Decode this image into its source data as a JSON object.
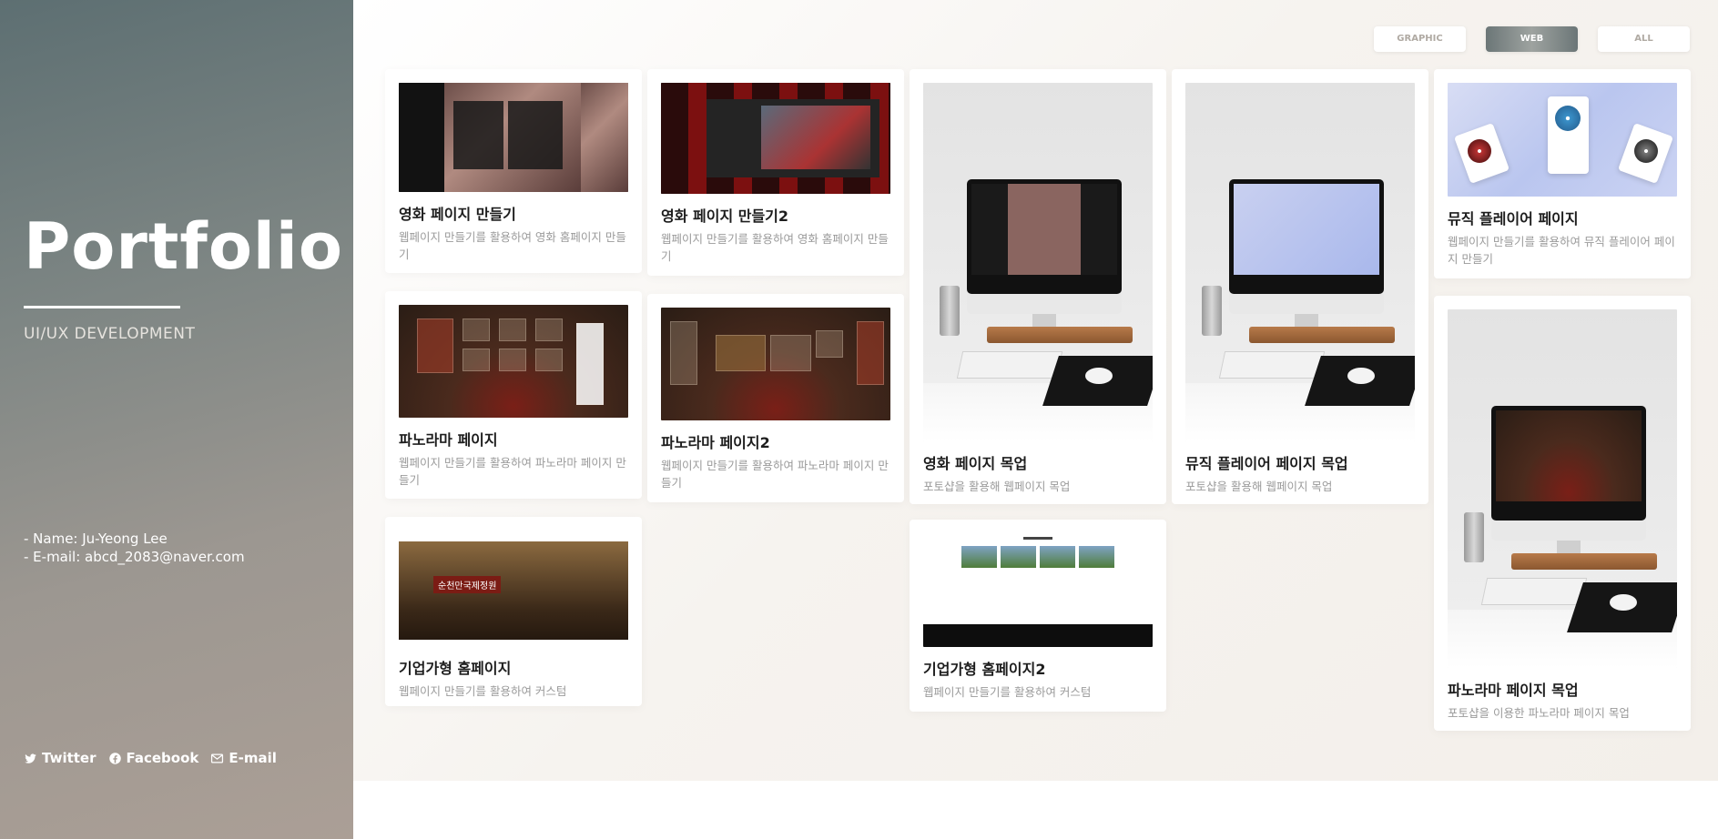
{
  "sidebar": {
    "title": "Portfolio",
    "subtitle": "UI/UX DEVELOPMENT",
    "name_line": "- Name: Ju-Yeong Lee",
    "email_line": "- E-mail: abcd_2083@naver.com",
    "social": [
      {
        "label": "Twitter",
        "icon": "twitter-icon"
      },
      {
        "label": "Facebook",
        "icon": "facebook-icon"
      },
      {
        "label": "E-mail",
        "icon": "mail-icon"
      }
    ]
  },
  "filters": [
    {
      "label": "GRAPHIC",
      "active": false
    },
    {
      "label": "WEB",
      "active": true
    },
    {
      "label": "ALL",
      "active": false
    }
  ],
  "cards": [
    {
      "title": "영화 페이지 만들기",
      "desc": "웹페이지 만들기를 활용하여 영화 홈페이지 만들기"
    },
    {
      "title": "영화 페이지 만들기2",
      "desc": "웹페이지 만들기를 활용하여 영화 홈페이지 만들기"
    },
    {
      "title": "영화 페이지 목업",
      "desc": "포토샵을 활용해 웹페이지 목업"
    },
    {
      "title": "뮤직 플레이어 페이지 목업",
      "desc": "포토샵을 활용해 웹페이지 목업"
    },
    {
      "title": "뮤직 플레이어 페이지",
      "desc": "웹페이지 만들기를 활용하여 뮤직 플레이어 페이지 만들기"
    },
    {
      "title": "파노라마 페이지",
      "desc": "웹페이지 만들기를 활용하여 파노라마 페이지 만들기"
    },
    {
      "title": "파노라마 페이지2",
      "desc": "웹페이지 만들기를 활용하여 파노라마 페이지 만들기"
    },
    {
      "title": "파노라마 페이지 목업",
      "desc": "포토샵을 이용한 파노라마 페이지 목업"
    },
    {
      "title": "기업가형 홈페이지",
      "desc": "웹페이지 만들기를 활용하여 커스텀",
      "thumb_label": "순천만국제정원"
    },
    {
      "title": "기업가형 홈페이지2",
      "desc": "웹페이지 만들기를 활용하여 커스텀"
    }
  ],
  "colors": {
    "sidebar_top": "#5d6f72",
    "sidebar_bottom": "#ab9f96",
    "filter_active": "#6b7677"
  }
}
